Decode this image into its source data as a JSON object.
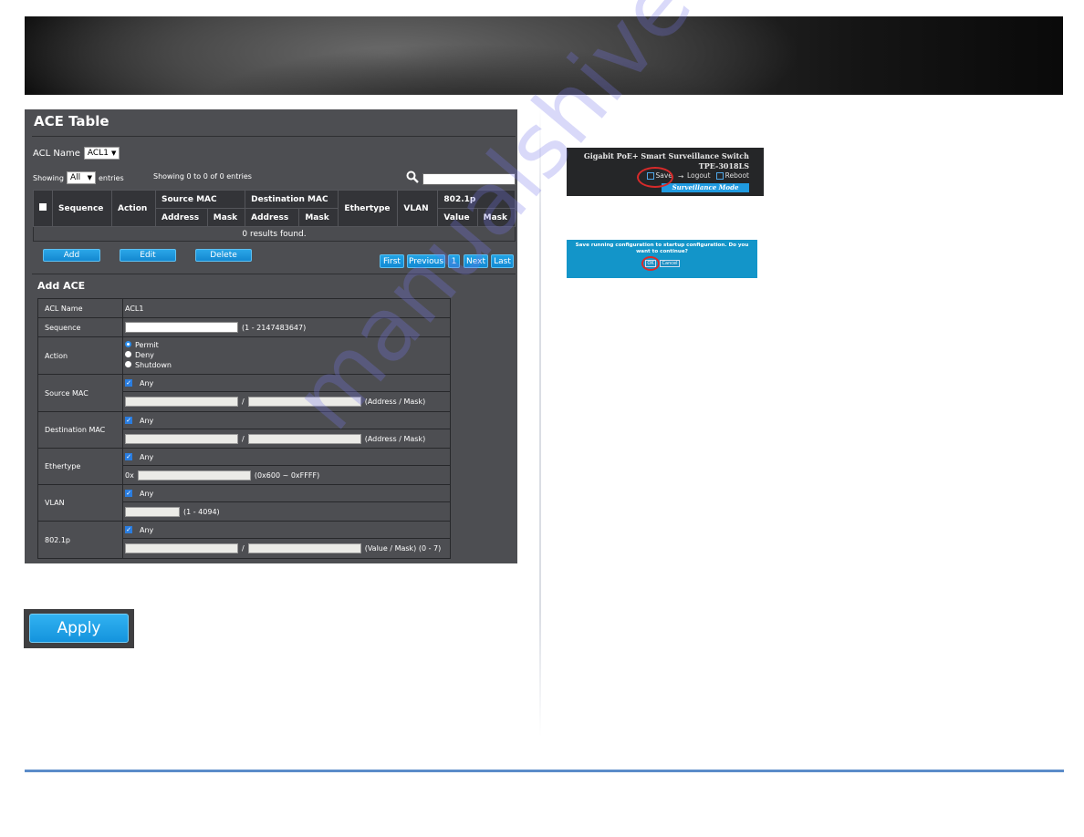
{
  "ace_table": {
    "title": "ACE Table",
    "acl_name_label": "ACL Name",
    "acl_name_selected": "ACL1",
    "showing_label": "Showing",
    "showing_selected": "All",
    "entries_label": "entries",
    "showing_info": "Showing 0 to 0 of 0 entries",
    "search_value": "",
    "columns": {
      "sequence": "Sequence",
      "action": "Action",
      "source_mac": "Source MAC",
      "destination_mac": "Destination MAC",
      "ethertype": "Ethertype",
      "vlan": "VLAN",
      "p8021": "802.1p",
      "address": "Address",
      "mask": "Mask",
      "value": "Value"
    },
    "empty_message": "0 results found.",
    "buttons": {
      "add": "Add",
      "edit": "Edit",
      "delete": "Delete"
    },
    "pagination": {
      "first": "First",
      "previous": "Previous",
      "page": "1",
      "next": "Next",
      "last": "Last"
    }
  },
  "add_ace": {
    "title": "Add ACE",
    "acl_name_label": "ACL Name",
    "acl_name_value": "ACL1",
    "sequence_label": "Sequence",
    "sequence_value": "",
    "sequence_hint": "(1 - 2147483647)",
    "action_label": "Action",
    "action_options": [
      "Permit",
      "Deny",
      "Shutdown"
    ],
    "action_selected": "Permit",
    "source_mac_label": "Source MAC",
    "destination_mac_label": "Destination MAC",
    "ethertype_label": "Ethertype",
    "vlan_label": "VLAN",
    "p8021_label": "802.1p",
    "any_label": "Any",
    "any_checked": true,
    "separator": "/",
    "address_mask_hint": "(Address / Mask)",
    "ethertype_prefix": "0x",
    "ethertype_hint": "(0x600 ~ 0xFFFF)",
    "vlan_hint": "(1 - 4094)",
    "p8021_hint": "(Value / Mask) (0 - 7)"
  },
  "apply_button": "Apply",
  "device_header": {
    "title": "Gigabit PoE+ Smart Surveillance Switch",
    "model": "TPE-3018LS",
    "save": "Save",
    "logout": "Logout",
    "reboot": "Reboot",
    "mode": "Surveillance Mode"
  },
  "save_dialog": {
    "message": "Save running configuration to startup configuration. Do you want to continue?",
    "ok": "OK",
    "cancel": "Cancel"
  },
  "watermark": "manualshive.com",
  "colors": {
    "accent_blue": "#1e9be3",
    "panel_bg": "#4d4e52",
    "footer_line": "#5b8cc9",
    "highlight_red": "#d82a2a"
  }
}
